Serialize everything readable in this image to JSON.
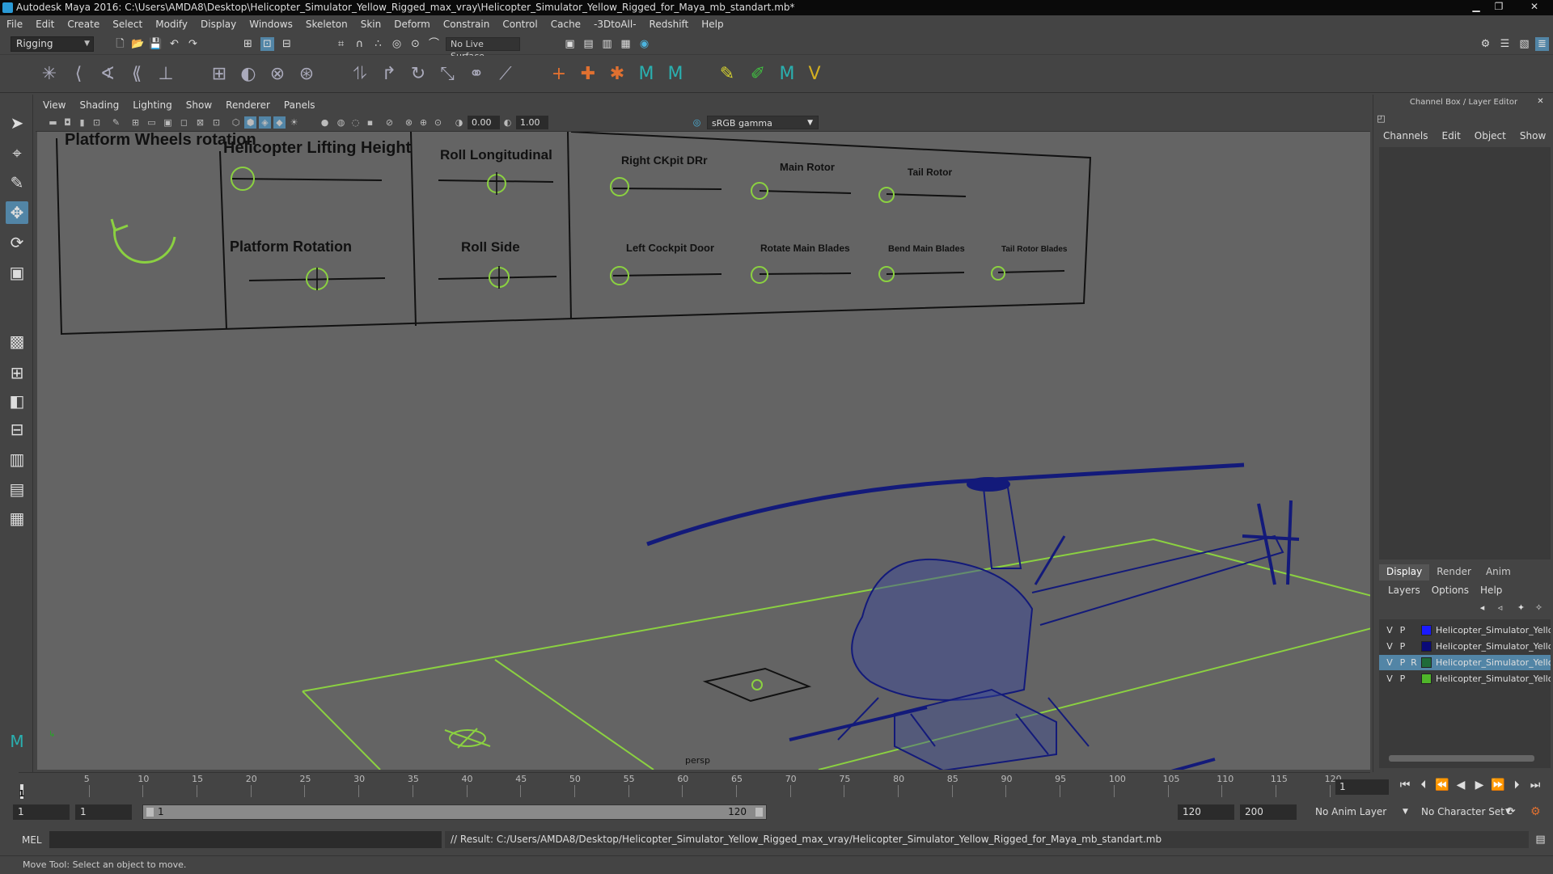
{
  "window": {
    "title": "Autodesk Maya 2016: C:\\Users\\AMDA8\\Desktop\\Helicopter_Simulator_Yellow_Rigged_max_vray\\Helicopter_Simulator_Yellow_Rigged_for_Maya_mb_standart.mb*",
    "minimize": "▁",
    "restore": "❐",
    "close": "✕"
  },
  "menubar": [
    "File",
    "Edit",
    "Create",
    "Select",
    "Modify",
    "Display",
    "Windows",
    "Skeleton",
    "Skin",
    "Deform",
    "Constrain",
    "Control",
    "Cache",
    "-3DtoAll-",
    "Redshift",
    "Help"
  ],
  "statusline": {
    "mode": "Rigging",
    "live_surface": "No Live Surface"
  },
  "panel": {
    "menu": [
      "View",
      "Shading",
      "Lighting",
      "Show",
      "Renderer",
      "Panels"
    ],
    "exposure": "0.00",
    "gamma": "1.00",
    "color_space": "sRGB gamma",
    "camera_label": "persp"
  },
  "controls": {
    "platform_wheels_rotation": "Platform Wheels rotation",
    "helicopter_lifting_height": "Helicopter Lifting Height",
    "roll_longitudinal": "Roll Longitudinal",
    "platform_rotation": "Platform Rotation",
    "roll_side": "Roll Side",
    "right_cockpit_door": "Right CKpit DRr",
    "main_rotor": "Main Rotor",
    "tail_rotor": "Tail Rotor",
    "left_cockpit_door": "Left Cockpit Door",
    "rotate_main_blades": "Rotate Main Blades",
    "bend_main_blades": "Bend Main Blades",
    "tail_rotor_blades": "Tail Rotor Blades"
  },
  "channelbox": {
    "title": "Channel Box / Layer Editor",
    "menu": [
      "Channels",
      "Edit",
      "Object",
      "Show"
    ],
    "layer_tabs": [
      "Display",
      "Render",
      "Anim"
    ],
    "layer_menu": [
      "Layers",
      "Options",
      "Help"
    ],
    "layers": [
      {
        "v": "V",
        "p": "P",
        "r": "",
        "color": "#1a1aff",
        "name": "Helicopter_Simulator_Yellow"
      },
      {
        "v": "V",
        "p": "P",
        "r": "",
        "color": "#0a0a78",
        "name": "Helicopter_Simulator_Yellow"
      },
      {
        "v": "V",
        "p": "P",
        "r": "R",
        "color": "#1f6b3a",
        "name": "Helicopter_Simulator_Yellow",
        "selected": true
      },
      {
        "v": "V",
        "p": "P",
        "r": "",
        "color": "#4fb52a",
        "name": "Helicopter_Simulator_Yellow"
      }
    ]
  },
  "timeslider": {
    "ticks": [
      "5",
      "10",
      "15",
      "20",
      "25",
      "30",
      "35",
      "40",
      "45",
      "50",
      "55",
      "60",
      "65",
      "70",
      "75",
      "80",
      "85",
      "90",
      "95",
      "100",
      "105",
      "110",
      "115",
      "120"
    ],
    "current_frame": "1",
    "frame_field": "1"
  },
  "range": {
    "start": "1",
    "playback_start": "1",
    "bar_start": "1",
    "bar_end": "120",
    "playback_end": "120",
    "end": "200",
    "anim_layer": "No Anim Layer",
    "char_set": "No Character Set"
  },
  "cmdline": {
    "lang": "MEL",
    "result": "// Result: C:/Users/AMDA8/Desktop/Helicopter_Simulator_Yellow_Rigged_max_vray/Helicopter_Simulator_Yellow_Rigged_for_Maya_mb_standart.mb"
  },
  "helpline": "Move Tool: Select an object to move."
}
